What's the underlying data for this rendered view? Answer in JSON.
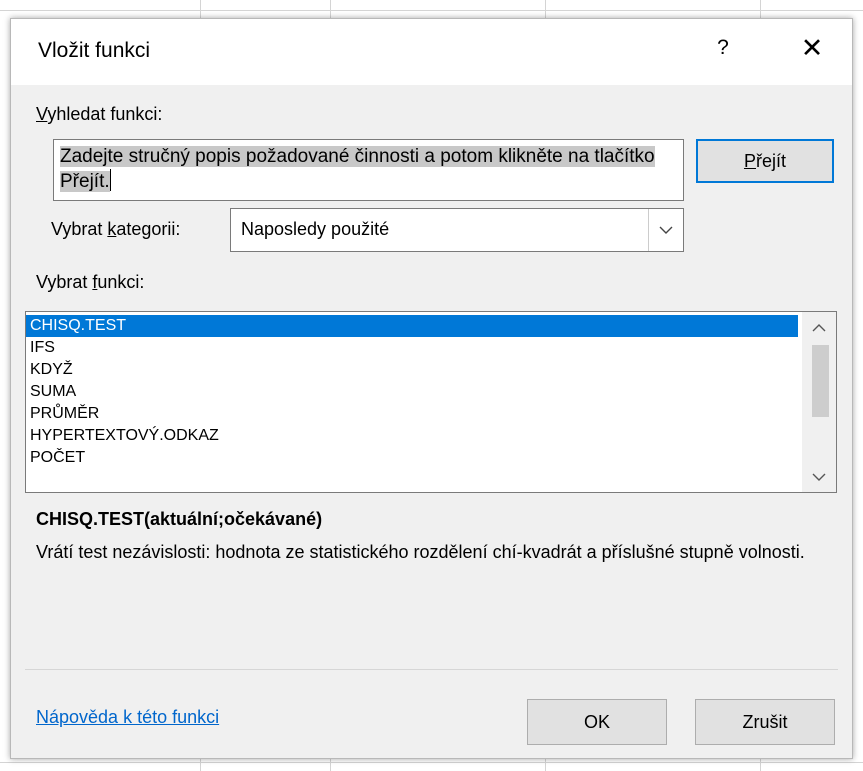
{
  "dialog": {
    "title": "Vložit funkci",
    "help_glyph": "?",
    "close_glyph": "✕"
  },
  "search": {
    "label_accel": "V",
    "label_rest": "yhledat funkci:",
    "value": "Zadejte stručný popis požadované činnosti a potom klikněte na tlačítko Přejít.",
    "go_accel": "P",
    "go_rest": "řejít"
  },
  "category": {
    "label_pre": "Vybrat ",
    "label_accel": "k",
    "label_post": "ategorii:",
    "selected": "Naposledy použité"
  },
  "functions": {
    "label_pre": "Vybrat ",
    "label_accel": "f",
    "label_post": "unkci:",
    "items": [
      "CHISQ.TEST",
      "IFS",
      "KDYŽ",
      "SUMA",
      "PRŮMĚR",
      "HYPERTEXTOVÝ.ODKAZ",
      "POČET"
    ],
    "selected_index": 0
  },
  "details": {
    "syntax": "CHISQ.TEST(aktuální;očekávané)",
    "description": "Vrátí test nezávislosti: hodnota ze statistického rozdělení chí-kvadrát a příslušné stupně volnosti."
  },
  "footer": {
    "help_link": "Nápověda k této funkci",
    "ok_label": "OK",
    "cancel_label": "Zrušit"
  },
  "colors": {
    "selection": "#0078d7",
    "link": "#0066cc",
    "dialog_bg": "#f0f0f0"
  }
}
